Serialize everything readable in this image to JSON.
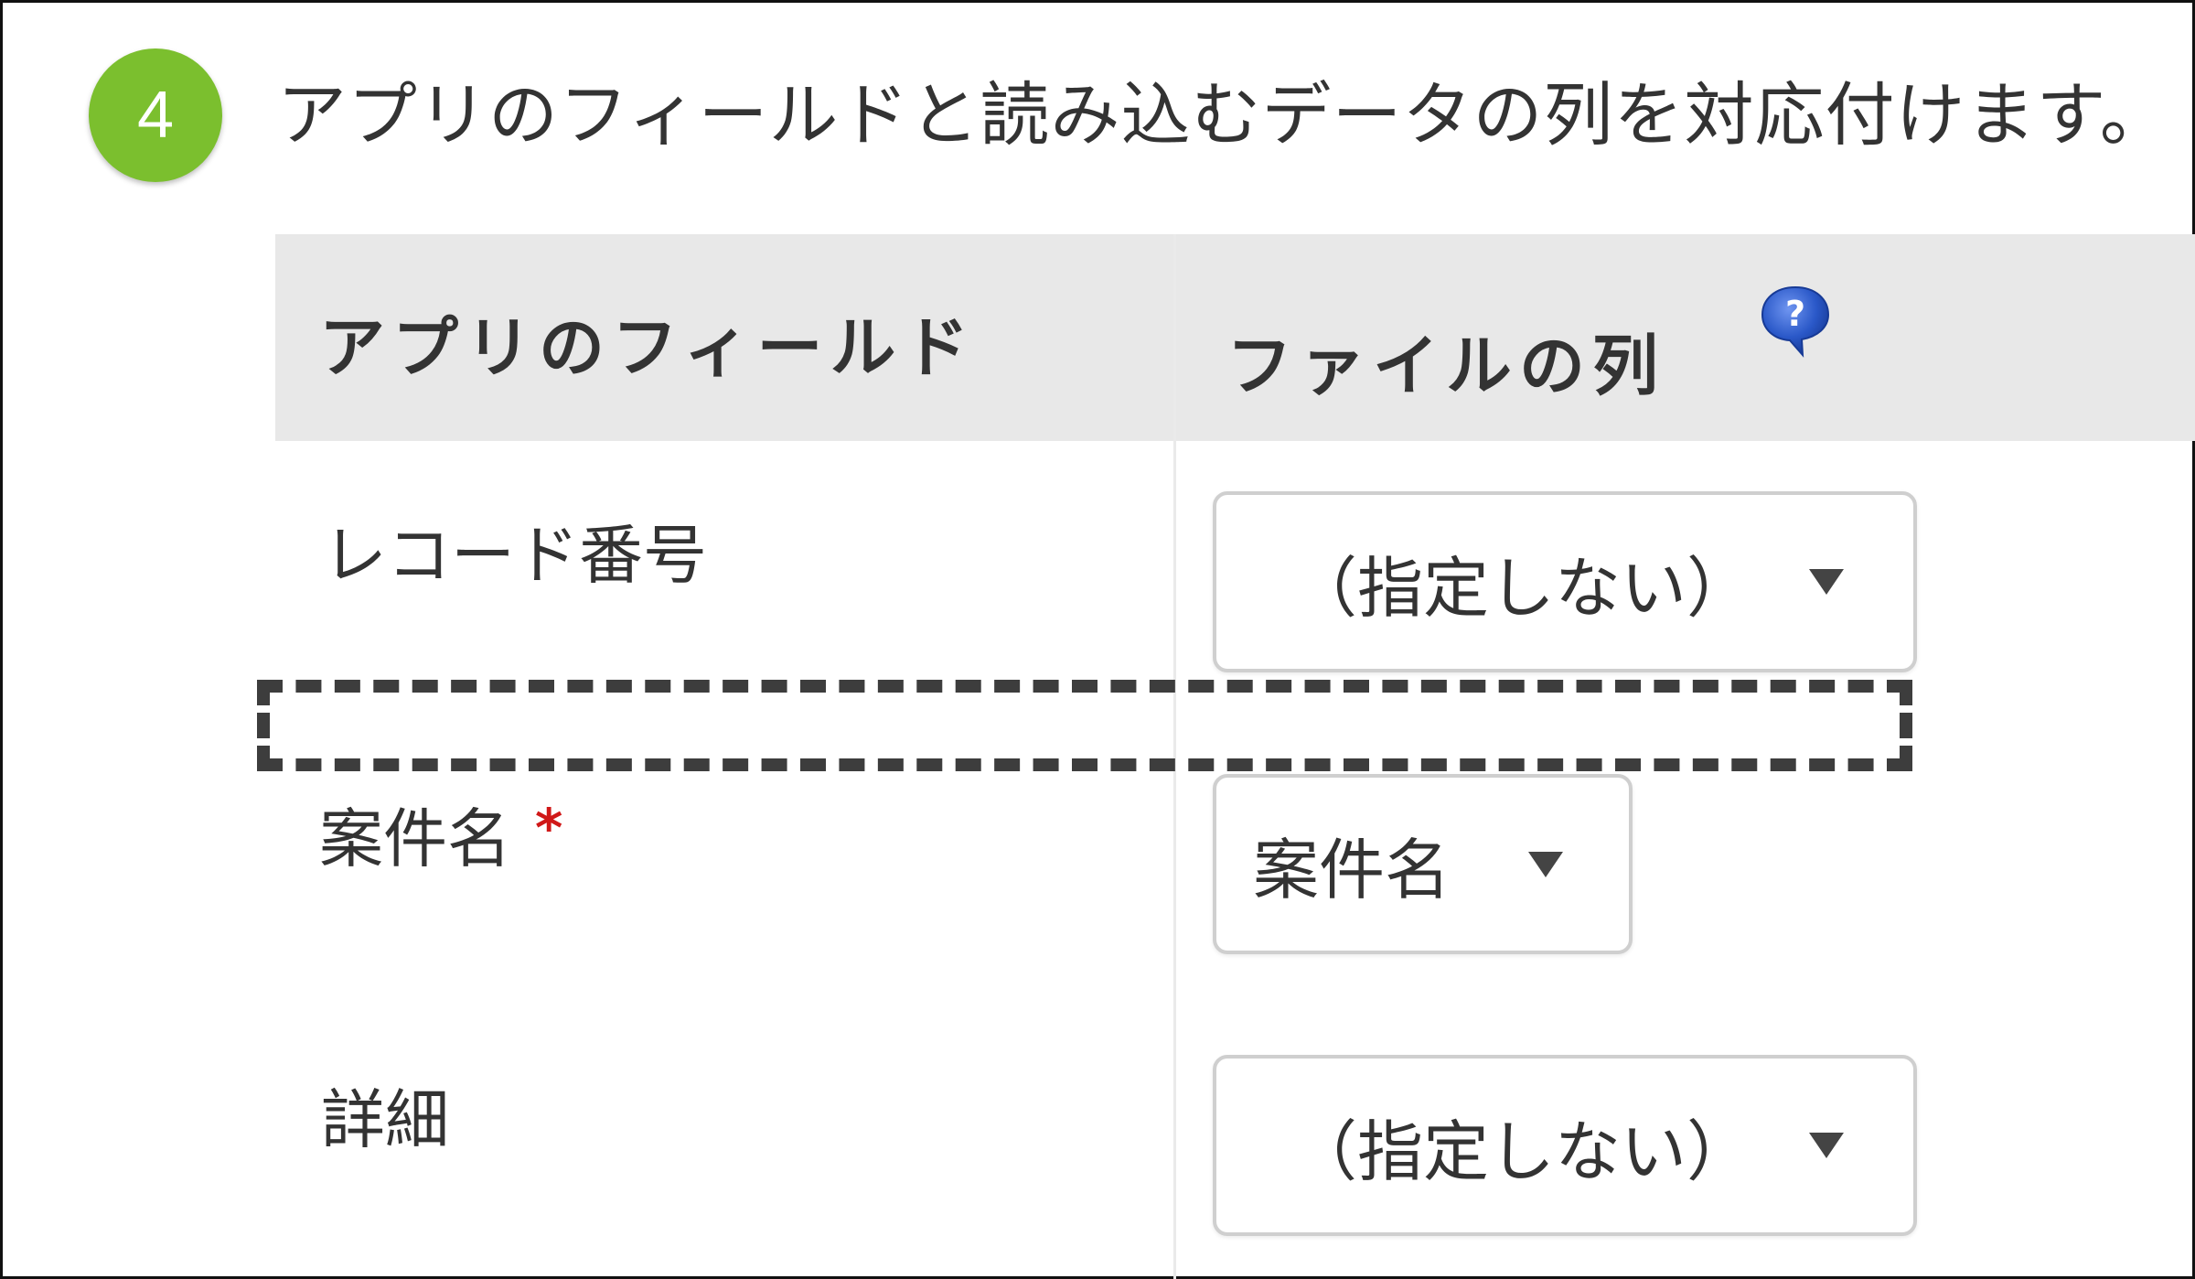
{
  "step": {
    "number": "4",
    "instruction": "アプリのフィールドと読み込むデータの列を対応付けます。"
  },
  "table": {
    "headers": {
      "app_field": "アプリのフィールド",
      "file_column": "ファイルの列"
    },
    "help_icon": "help-question-icon",
    "rows": [
      {
        "field": "レコード番号",
        "required": false,
        "selected": "（指定しない）"
      },
      {
        "field": "案件名",
        "required": true,
        "required_mark": "*",
        "selected": "案件名"
      },
      {
        "field": "詳細",
        "required": false,
        "selected": "（指定しない）"
      }
    ]
  },
  "colors": {
    "step_badge": "#7bbf2e",
    "required_mark": "#d01818",
    "header_bg": "#e8e8e8",
    "help_icon": "#2a58c8"
  }
}
